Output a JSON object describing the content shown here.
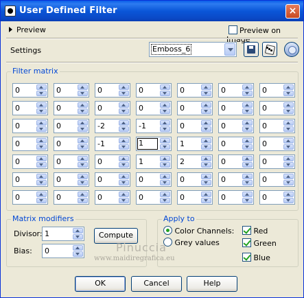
{
  "window": {
    "title": "User Defined Filter",
    "close_glyph": "×"
  },
  "preview": {
    "toggle_label": "Preview",
    "on_image_label": "Preview on Image",
    "on_image_checked": false
  },
  "settings": {
    "label": "Settings",
    "preset_value": "Emboss_6",
    "icons": [
      "save-preset-icon",
      "randomize-icon",
      "reset-icon"
    ]
  },
  "filter_matrix": {
    "title": "Filter matrix",
    "rows": [
      [
        "0",
        "0",
        "0",
        "0",
        "0",
        "0",
        "0"
      ],
      [
        "0",
        "0",
        "0",
        "0",
        "0",
        "0",
        "0"
      ],
      [
        "0",
        "0",
        "-2",
        "-1",
        "0",
        "0",
        "0"
      ],
      [
        "0",
        "0",
        "-1",
        "1",
        "1",
        "0",
        "0"
      ],
      [
        "0",
        "0",
        "0",
        "1",
        "2",
        "0",
        "0"
      ],
      [
        "0",
        "0",
        "0",
        "0",
        "0",
        "0",
        "0"
      ],
      [
        "0",
        "0",
        "0",
        "0",
        "0",
        "0",
        "0"
      ]
    ]
  },
  "modifiers": {
    "title": "Matrix modifiers",
    "divisor_label": "Divisor:",
    "divisor": "1",
    "bias_label": "Bias:",
    "bias": "0",
    "compute_label": "Compute"
  },
  "apply_to": {
    "title": "Apply to",
    "color_channels_label": "Color Channels:",
    "grey_values_label": "Grey values",
    "selected": "color_channels",
    "red_label": "Red",
    "green_label": "Green",
    "blue_label": "Blue",
    "red": true,
    "green": true,
    "blue": true
  },
  "watermark": {
    "name": "Pinuccia",
    "url": "www.maidiregrafica.eu"
  },
  "buttons": {
    "ok": "OK",
    "cancel": "Cancel",
    "help": "Help"
  },
  "colors": {
    "titlebar": "#0a56d8",
    "dialog_bg": "#ece9d8",
    "group_title": "#0046d5",
    "check": "#21a121"
  }
}
